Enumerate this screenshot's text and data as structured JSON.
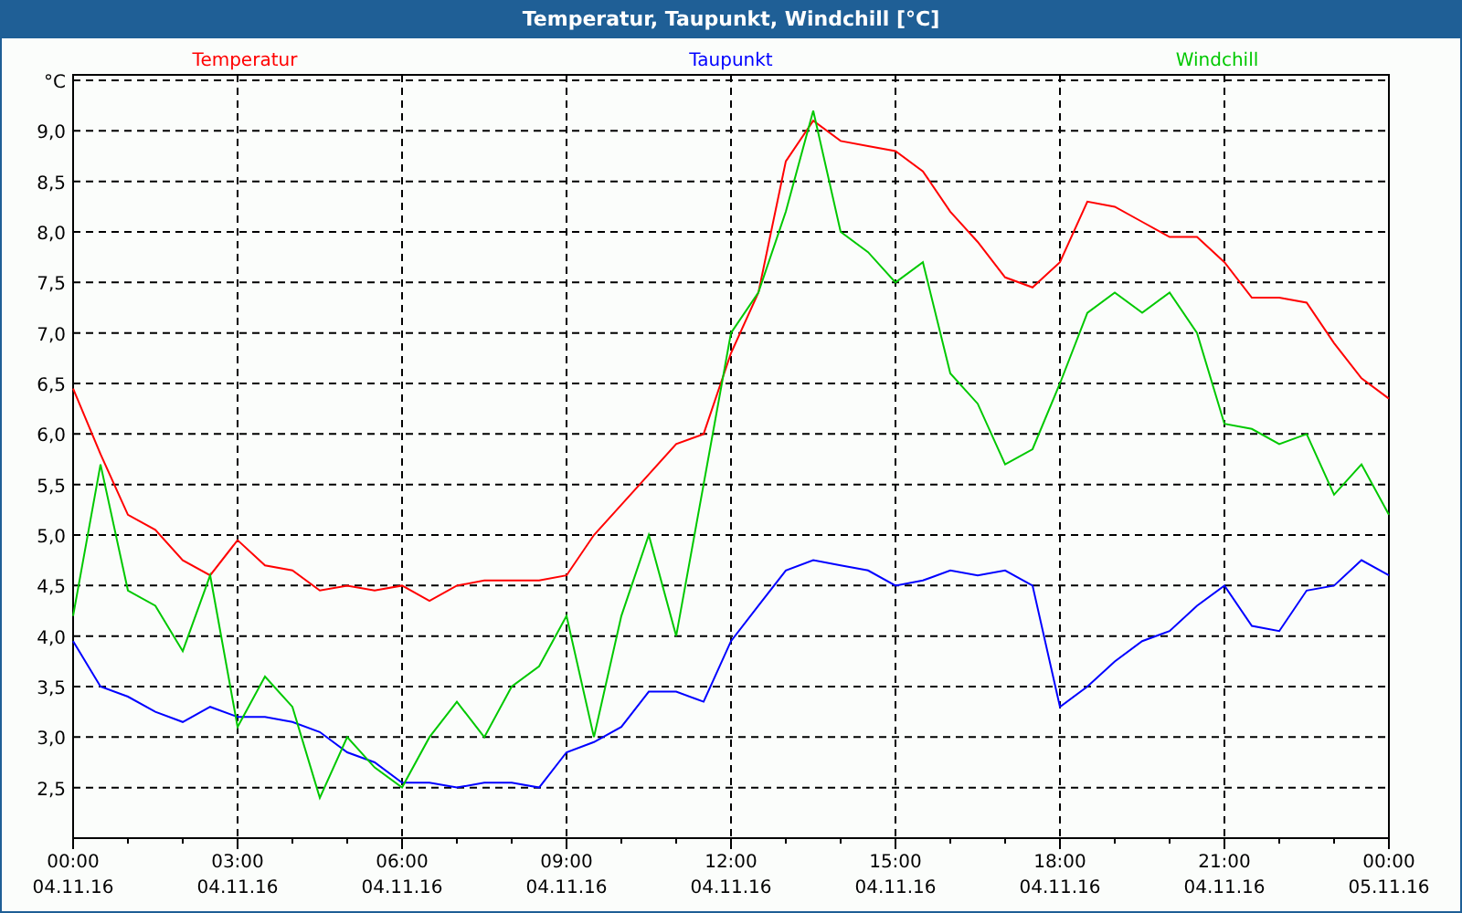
{
  "window": {
    "title": "Temperatur, Taupunkt, Windchill [°C]"
  },
  "chart": {
    "chart_data": {
      "type": "line",
      "ylabel": "°C",
      "categories": [
        "00:00 04.11.16",
        null,
        null,
        null,
        null,
        null,
        "03:00 04.11.16",
        null,
        null,
        null,
        null,
        null,
        "06:00 04.11.16",
        null,
        null,
        null,
        null,
        null,
        "09:00 04.11.16",
        null,
        null,
        null,
        null,
        null,
        "12:00 04.11.16",
        null,
        null,
        null,
        null,
        null,
        "15:00 04.11.16",
        null,
        null,
        null,
        null,
        null,
        "18:00 04.11.16",
        null,
        null,
        null,
        null,
        null,
        "21:00 04.11.16",
        null,
        null,
        null,
        null,
        null,
        "00:00 05.11.16"
      ],
      "ylim": [
        2.0,
        9.5
      ],
      "grid": true,
      "yticks": [
        {
          "value": 2.5,
          "label": "2,5"
        },
        {
          "value": 3,
          "label": "3,0"
        },
        {
          "value": 3.5,
          "label": "3,5"
        },
        {
          "value": 4,
          "label": "4,0"
        },
        {
          "value": 4.5,
          "label": "4,5"
        },
        {
          "value": 5,
          "label": "5,0"
        },
        {
          "value": 5.5,
          "label": "5,5"
        },
        {
          "value": 6,
          "label": "6,0"
        },
        {
          "value": 6.5,
          "label": "6,5"
        },
        {
          "value": 7,
          "label": "7,0"
        },
        {
          "value": 7.5,
          "label": "7,5"
        },
        {
          "value": 8,
          "label": "8,0"
        },
        {
          "value": 8.5,
          "label": "8,5"
        },
        {
          "value": 9,
          "label": "9,0"
        }
      ],
      "series": [
        {
          "name": "Temperatur",
          "color": "#ff0000",
          "values": [
            6.45,
            5.8,
            5.2,
            5.05,
            4.75,
            4.6,
            4.95,
            4.7,
            4.65,
            4.45,
            4.5,
            4.45,
            4.5,
            4.35,
            4.5,
            4.55,
            4.55,
            4.55,
            4.6,
            5.0,
            5.3,
            5.6,
            5.9,
            6.0,
            6.8,
            7.4,
            8.7,
            9.1,
            8.9,
            8.85,
            8.8,
            8.6,
            8.2,
            7.9,
            7.55,
            7.45,
            7.7,
            8.3,
            8.25,
            8.1,
            7.95,
            7.95,
            7.7,
            7.35,
            7.35,
            7.3,
            6.9,
            6.55,
            6.35
          ]
        },
        {
          "name": "Taupunkt",
          "color": "#0000ff",
          "values": [
            3.95,
            3.5,
            3.4,
            3.25,
            3.15,
            3.3,
            3.2,
            3.2,
            3.15,
            3.05,
            2.85,
            2.75,
            2.55,
            2.55,
            2.5,
            2.55,
            2.55,
            2.5,
            2.85,
            2.95,
            3.1,
            3.45,
            3.45,
            3.35,
            3.95,
            4.3,
            4.65,
            4.75,
            4.7,
            4.65,
            4.5,
            4.55,
            4.65,
            4.6,
            4.65,
            4.5,
            3.3,
            3.5,
            3.75,
            3.95,
            4.05,
            4.3,
            4.5,
            4.1,
            4.05,
            4.45,
            4.5,
            4.75,
            4.6
          ]
        },
        {
          "name": "Windchill",
          "color": "#00c800",
          "values": [
            4.2,
            5.7,
            4.45,
            4.3,
            3.85,
            4.6,
            3.1,
            3.6,
            3.3,
            2.4,
            3.0,
            2.7,
            2.5,
            3.0,
            3.35,
            3.0,
            3.5,
            3.7,
            4.2,
            3.0,
            4.2,
            5.0,
            4.0,
            5.5,
            7.0,
            7.4,
            8.2,
            9.2,
            8.0,
            7.8,
            7.5,
            7.7,
            6.6,
            6.3,
            5.7,
            5.85,
            6.5,
            7.2,
            7.4,
            7.2,
            7.4,
            7.0,
            6.1,
            6.05,
            5.9,
            6.0,
            5.4,
            5.7,
            5.2
          ]
        }
      ]
    }
  }
}
